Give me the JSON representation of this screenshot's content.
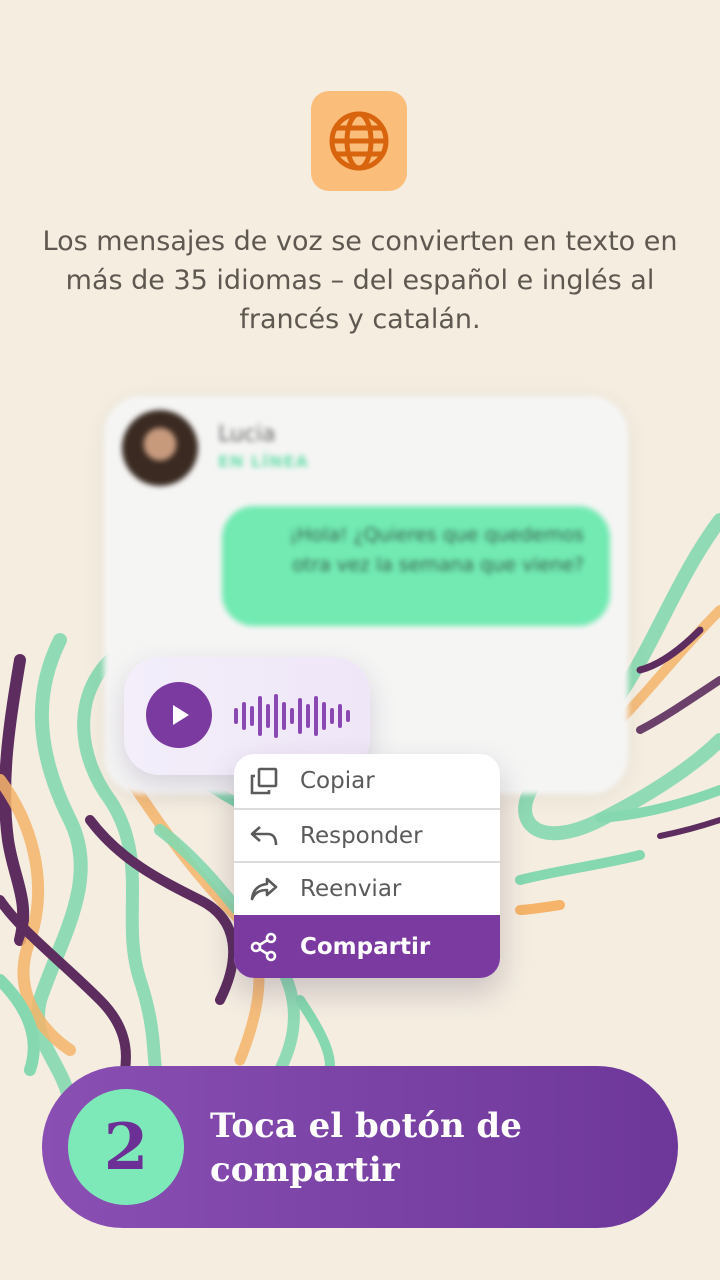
{
  "intro_text": "Los mensajes de voz se convierten en texto en más de 35 idiomas – del español e inglés al francés y catalán.",
  "icons": {
    "header": "globe-icon",
    "play": "play-icon",
    "waveform": "waveform-icon",
    "copy": "copy-icon",
    "reply": "reply-icon",
    "forward": "forward-icon",
    "share": "share-icon"
  },
  "chat": {
    "contact_name": "Lucia",
    "contact_status": "EN LÍNEA",
    "message": "¡Hola! ¿Quieres que quedemos otra vez la semana que viene?"
  },
  "context_menu": {
    "items": [
      {
        "label": "Copiar",
        "icon": "copy-icon"
      },
      {
        "label": "Responder",
        "icon": "reply-icon"
      },
      {
        "label": "Reenviar",
        "icon": "forward-icon"
      },
      {
        "label": "Compartir",
        "icon": "share-icon",
        "highlighted": true
      }
    ]
  },
  "step": {
    "number": "2",
    "text": "Toca el botón de compartir"
  },
  "colors": {
    "background": "#f4ede0",
    "purple": "#7b3aa0",
    "mint": "#72eab2",
    "orange_badge": "#fbbd7a",
    "orange_icon": "#d9640e"
  }
}
